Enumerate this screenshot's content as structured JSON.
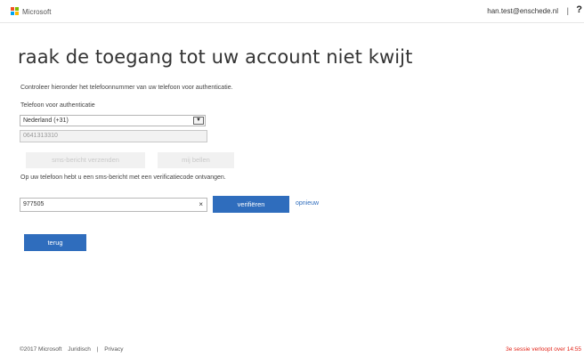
{
  "header": {
    "logo_text": "Microsoft",
    "user": "han.test@enschede.nl",
    "separator": "|",
    "help": "?"
  },
  "title": "raak de toegang tot uw account niet kwijt",
  "intro": "Controleer hieronder het telefoonnummer van uw telefoon voor authenticatie.",
  "phone": {
    "label": "Telefoon voor authenticatie",
    "country_selected": "Nederland (+31)",
    "number_value": "0641313310"
  },
  "actions": {
    "sms_label": "sms-bericht verzenden",
    "call_label": "mij bellen"
  },
  "sms_info": "Op uw telefoon hebt u een sms-bericht met een verificatiecode ontvangen.",
  "verification": {
    "code_value": "977505",
    "clear": "×",
    "verify_label": "verifiëren",
    "again_label": "opnieuw"
  },
  "back_label": "terug",
  "footer": {
    "copyright": "©2017 Microsoft",
    "legal": "Juridisch",
    "separator": "|",
    "privacy": "Privacy",
    "session": "3e sessie verloopt over 14:55"
  },
  "colors": {
    "accent": "#2f6dbd",
    "session_warning": "#e3251a",
    "logo": [
      "#f25022",
      "#7fba00",
      "#00a4ef",
      "#ffb900"
    ]
  }
}
